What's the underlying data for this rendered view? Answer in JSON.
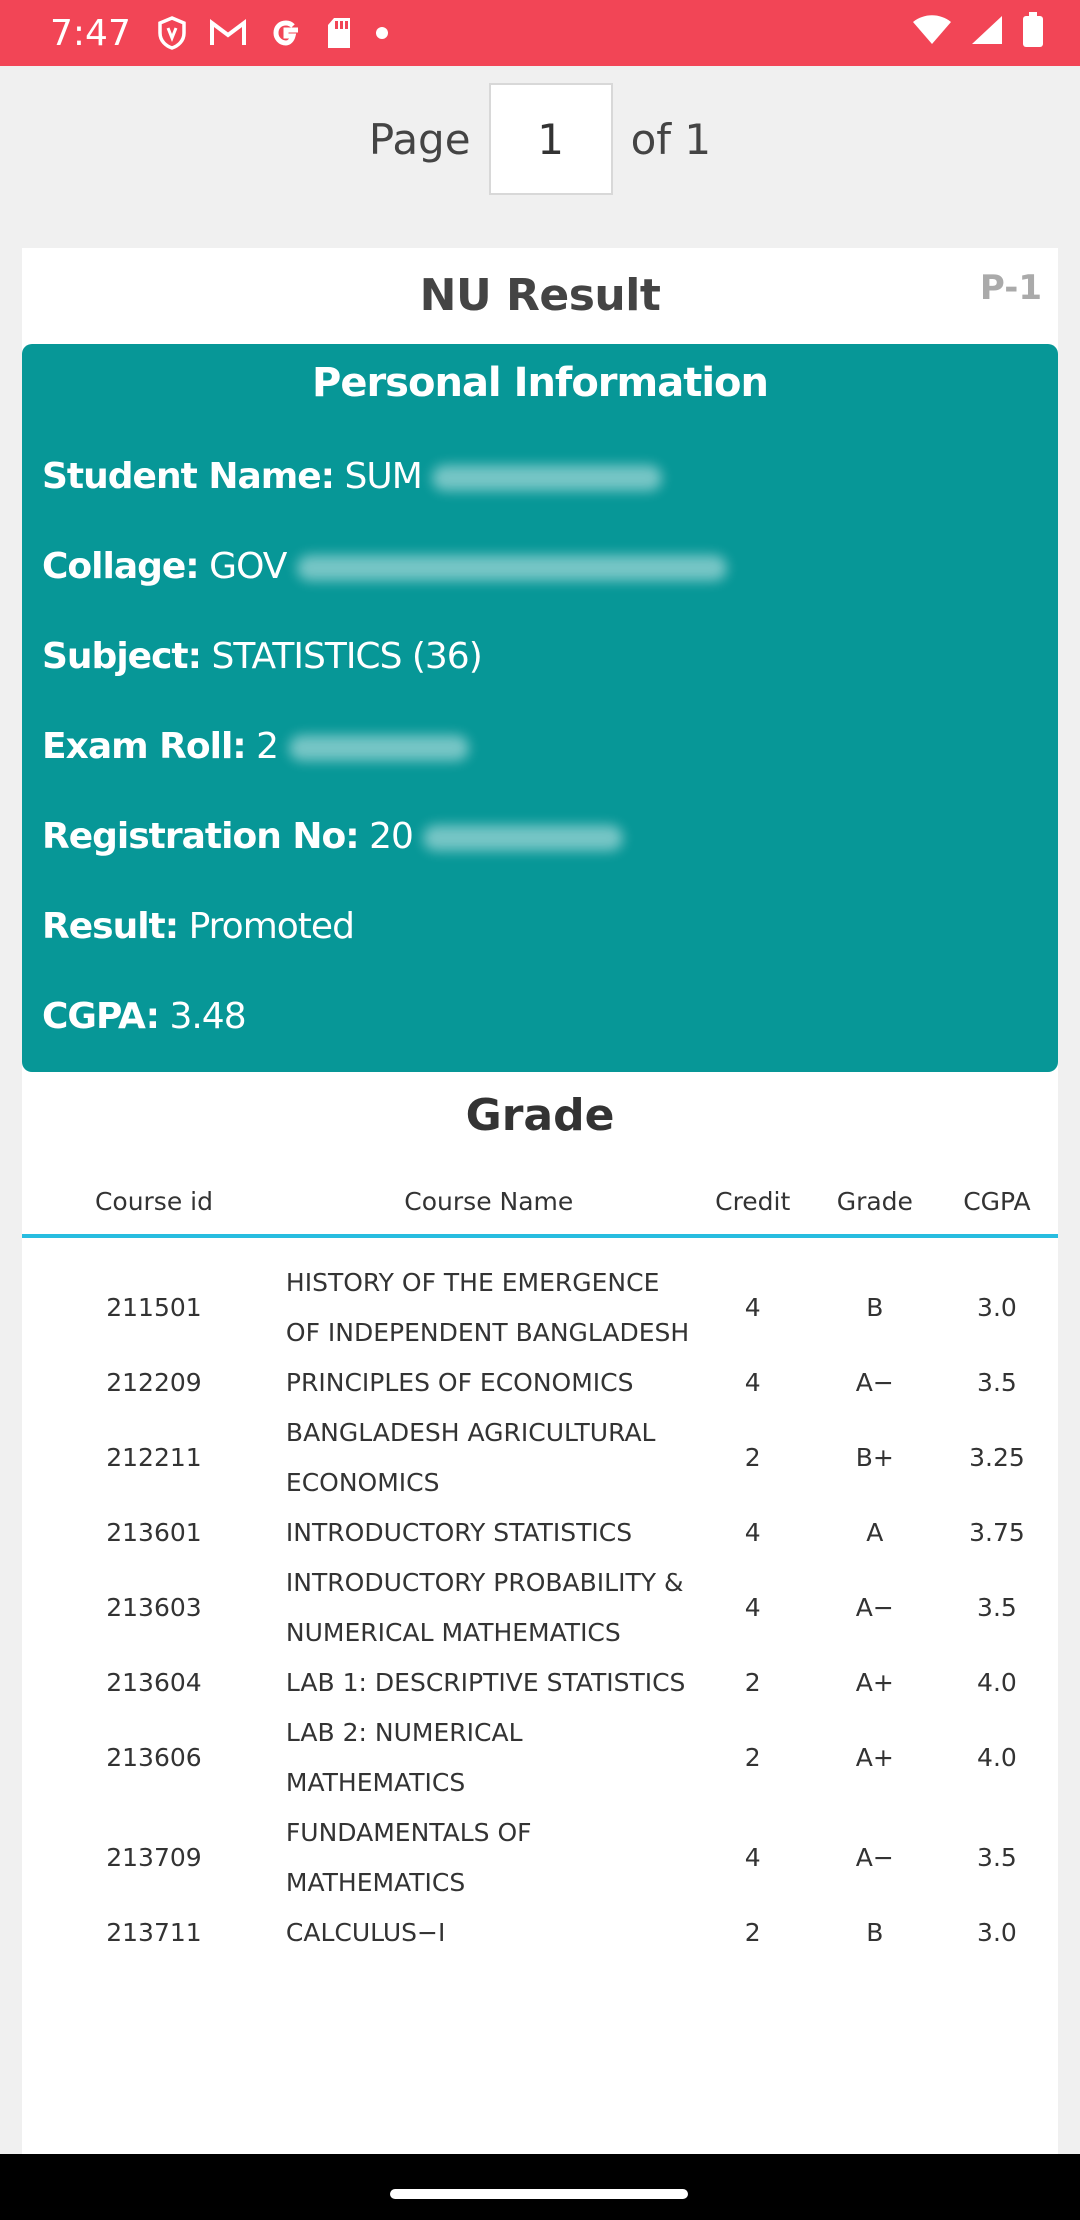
{
  "status_bar": {
    "time": "7:47",
    "icons": [
      "shield-icon",
      "gmail-icon",
      "google-icon",
      "sd-card-icon",
      "dot-icon",
      "wifi-icon",
      "signal-icon",
      "battery-icon"
    ]
  },
  "pager": {
    "page_label": "Page",
    "current_page": "1",
    "of_label": "of 1"
  },
  "card": {
    "title": "NU Result",
    "page_tag": "P-1"
  },
  "personal_info": {
    "title": "Personal Information",
    "student_name_label": "Student Name:",
    "student_name_value": "SUM",
    "college_label": "Collage:",
    "college_value": "GOV",
    "subject_label": "Subject:",
    "subject_value": "STATISTICS (36)",
    "exam_roll_label": "Exam Roll:",
    "exam_roll_value": "2",
    "registration_label": "Registration No:",
    "registration_value": "20",
    "result_label": "Result:",
    "result_value": "Promoted",
    "cgpa_label": "CGPA:",
    "cgpa_value": "3.48"
  },
  "grade": {
    "title": "Grade",
    "headers": [
      "Course id",
      "Course Name",
      "Credit",
      "Grade",
      "CGPA"
    ],
    "rows": [
      {
        "id": "211501",
        "name": "HISTORY OF THE EMERGENCE OF INDEPENDENT BANGLADESH",
        "credit": "4",
        "grade": "B",
        "cgpa": "3.0"
      },
      {
        "id": "212209",
        "name": "PRINCIPLES OF ECONOMICS",
        "credit": "4",
        "grade": "A−",
        "cgpa": "3.5"
      },
      {
        "id": "212211",
        "name": "BANGLADESH AGRICULTURAL ECONOMICS",
        "credit": "2",
        "grade": "B+",
        "cgpa": "3.25"
      },
      {
        "id": "213601",
        "name": "INTRODUCTORY STATISTICS",
        "credit": "4",
        "grade": "A",
        "cgpa": "3.75"
      },
      {
        "id": "213603",
        "name": "INTRODUCTORY PROBABILITY & NUMERICAL MATHEMATICS",
        "credit": "4",
        "grade": "A−",
        "cgpa": "3.5"
      },
      {
        "id": "213604",
        "name": "LAB 1: DESCRIPTIVE STATISTICS",
        "credit": "2",
        "grade": "A+",
        "cgpa": "4.0"
      },
      {
        "id": "213606",
        "name": "LAB 2: NUMERICAL MATHEMATICS",
        "credit": "2",
        "grade": "A+",
        "cgpa": "4.0"
      },
      {
        "id": "213709",
        "name": "FUNDAMENTALS OF MATHEMATICS",
        "credit": "4",
        "grade": "A−",
        "cgpa": "3.5"
      },
      {
        "id": "213711",
        "name": "CALCULUS−I",
        "credit": "2",
        "grade": "B",
        "cgpa": "3.0"
      }
    ]
  },
  "colors": {
    "status_bar": "#f24556",
    "info_panel": "#079797",
    "table_divider": "#27bde0"
  }
}
